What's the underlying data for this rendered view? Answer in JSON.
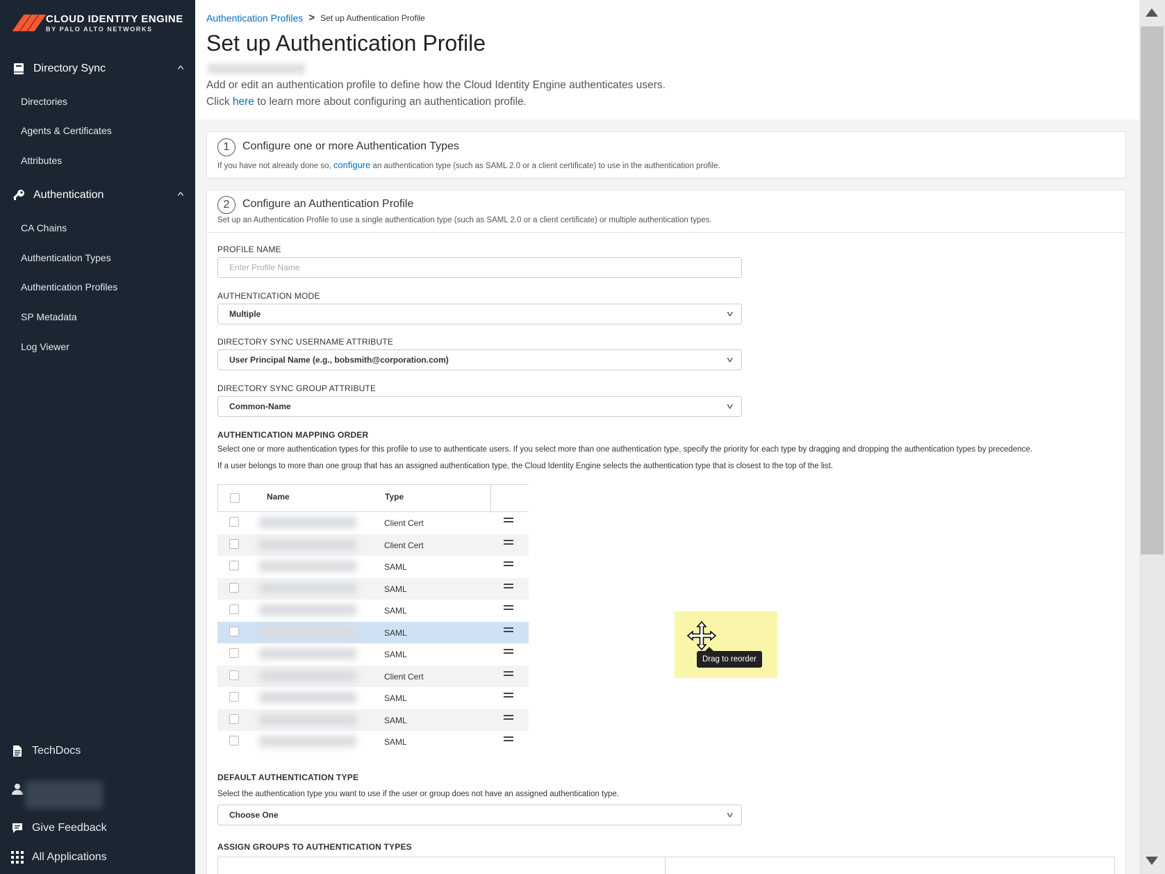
{
  "brand": {
    "title": "CLOUD IDENTITY ENGINE",
    "subtitle": "BY PALO ALTO NETWORKS",
    "accent": "#fa582d"
  },
  "sidebar": {
    "directory_sync": {
      "label": "Directory Sync",
      "items": [
        "Directories",
        "Agents & Certificates",
        "Attributes"
      ]
    },
    "authentication": {
      "label": "Authentication",
      "items": [
        "CA Chains",
        "Authentication Types",
        "Authentication Profiles",
        "SP Metadata",
        "Log Viewer"
      ]
    },
    "footer": {
      "techdocs": "TechDocs",
      "feedback": "Give Feedback",
      "all_apps": "All Applications"
    }
  },
  "breadcrumb": {
    "parent": "Authentication Profiles",
    "current": "Set up Authentication Profile"
  },
  "page": {
    "title": "Set up Authentication Profile",
    "desc_line1": "Add or edit an authentication profile to define how the Cloud Identity Engine authenticates users.",
    "desc_click": "Click ",
    "desc_link": "here",
    "desc_rest": " to learn more about configuring an authentication profile."
  },
  "step1": {
    "number": "1",
    "title": "Configure one or more Authentication Types",
    "desc_pre": "If you have not already done so, ",
    "desc_link": "configure",
    "desc_post": " an authentication type (such as SAML 2.0 or a client certificate) to use in the authentication profile."
  },
  "step2": {
    "number": "2",
    "title": "Configure an Authentication Profile",
    "desc": "Set up an Authentication Profile to use a single authentication type (such as SAML 2.0 or a client certificate) or multiple authentication types."
  },
  "form": {
    "profile_name": {
      "label": "PROFILE NAME",
      "placeholder": "Enter Profile Name",
      "value": ""
    },
    "auth_mode": {
      "label": "AUTHENTICATION MODE",
      "value": "Multiple"
    },
    "username_attr": {
      "label": "DIRECTORY SYNC USERNAME ATTRIBUTE",
      "value": "User Principal Name (e.g., bobsmith@corporation.com)"
    },
    "group_attr": {
      "label": "DIRECTORY SYNC GROUP ATTRIBUTE",
      "value": "Common-Name"
    },
    "mapping": {
      "label": "AUTHENTICATION MAPPING ORDER",
      "help1": "Select one or more authentication types for this profile to use to authenticate users. If you select more than one authentication type, specify the priority for each type by dragging and dropping the authentication types by precedence.",
      "help2": "If a user belongs to more than one group that has an assigned authentication type, the Cloud Identity Engine selects the authentication type that is closest to the top of the list.",
      "columns": {
        "name": "Name",
        "type": "Type"
      },
      "rows": [
        {
          "type": "Client Cert"
        },
        {
          "type": "Client Cert"
        },
        {
          "type": "SAML"
        },
        {
          "type": "SAML"
        },
        {
          "type": "SAML"
        },
        {
          "type": "SAML"
        },
        {
          "type": "SAML"
        },
        {
          "type": "Client Cert"
        },
        {
          "type": "SAML"
        },
        {
          "type": "SAML"
        },
        {
          "type": "SAML"
        }
      ],
      "tooltip": "Drag to reorder"
    },
    "default_type": {
      "label": "DEFAULT AUTHENTICATION TYPE",
      "help": "Select the authentication type you want to use if the user or group does not have an assigned authentication type.",
      "value": "Choose One"
    },
    "assign_groups": {
      "label": "ASSIGN GROUPS TO AUTHENTICATION TYPES"
    }
  }
}
